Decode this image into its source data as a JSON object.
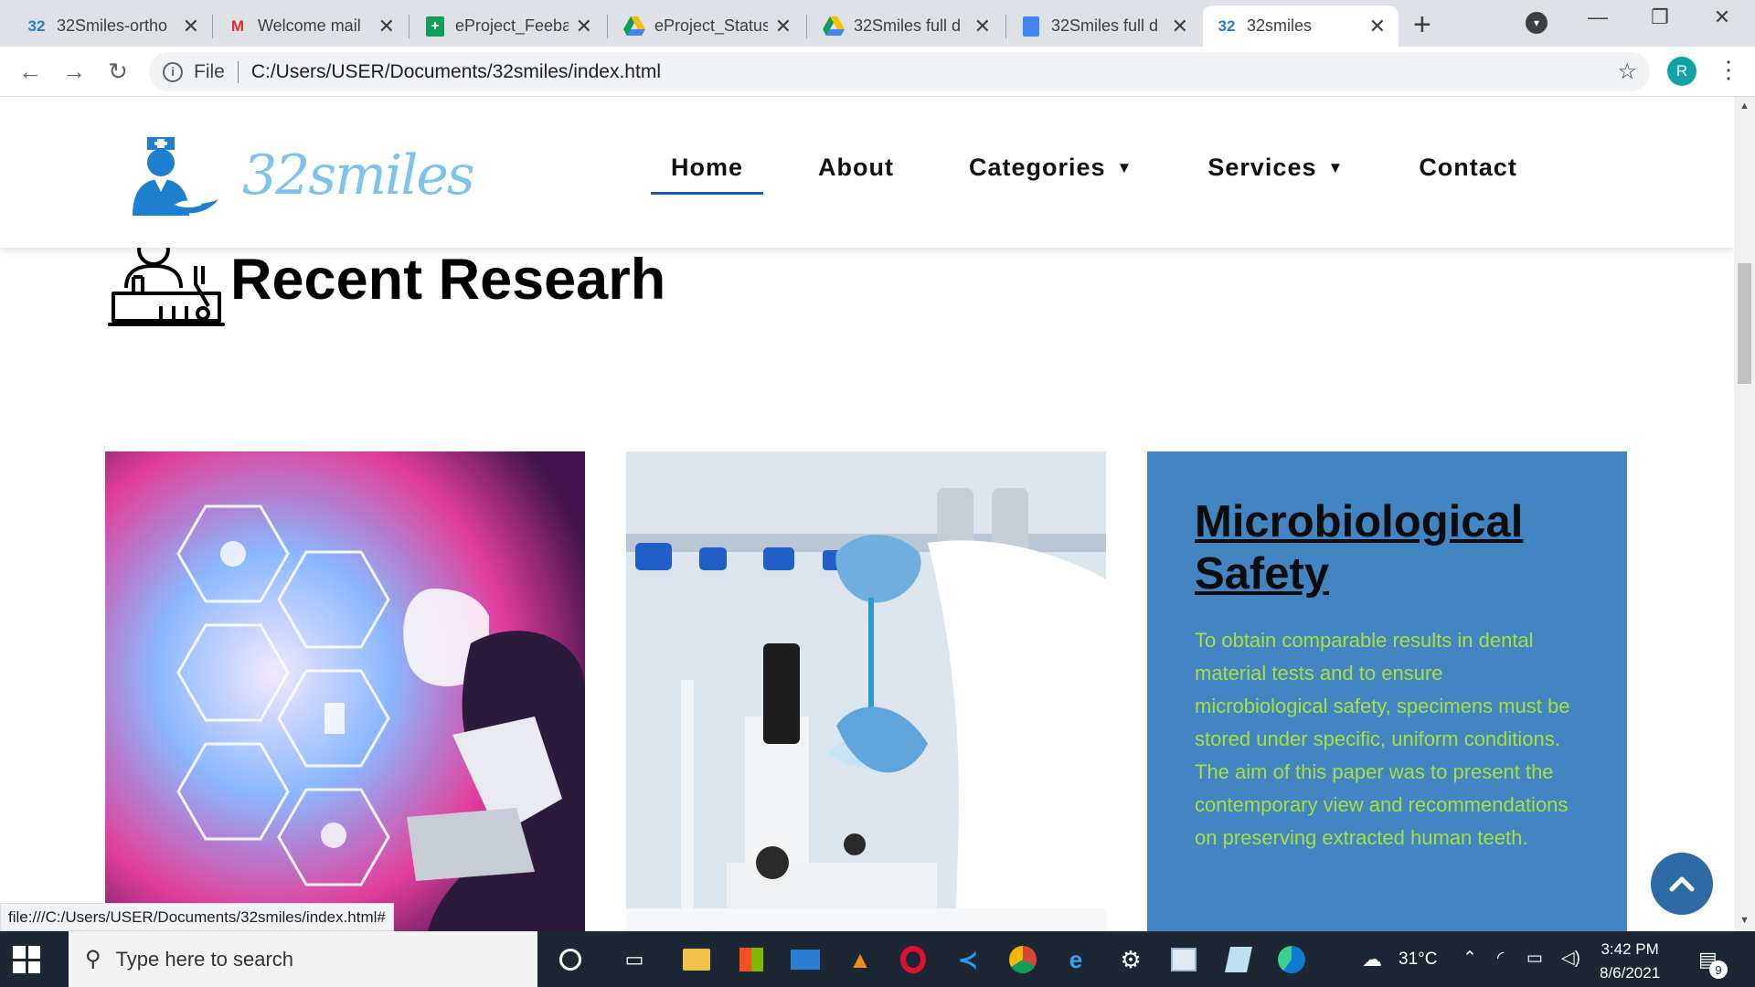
{
  "browser": {
    "tabs": [
      {
        "label": "32Smiles-ortho",
        "icon": "32-logo-icon"
      },
      {
        "label": "Welcome mail",
        "icon": "gmail-icon"
      },
      {
        "label": "eProject_Feeba",
        "icon": "sheets-icon"
      },
      {
        "label": "eProject_Status",
        "icon": "drive-icon"
      },
      {
        "label": "32Smiles full d",
        "icon": "drive-icon"
      },
      {
        "label": "32Smiles full d",
        "icon": "docs-icon"
      },
      {
        "label": "32smiles",
        "icon": "32-logo-icon"
      }
    ],
    "url_scheme": "File",
    "url": "C:/Users/USER/Documents/32smiles/index.html",
    "profile_initial": "R",
    "status_url": "file:///C:/Users/USER/Documents/32smiles/index.html#"
  },
  "site": {
    "logo_text": "32smiles",
    "nav": [
      {
        "label": "Home",
        "active": true,
        "dropdown": false
      },
      {
        "label": "About",
        "active": false,
        "dropdown": false
      },
      {
        "label": "Categories",
        "active": false,
        "dropdown": true
      },
      {
        "label": "Services",
        "active": false,
        "dropdown": true
      },
      {
        "label": "Contact",
        "active": false,
        "dropdown": false
      }
    ],
    "section_title": "Recent Researh",
    "card3": {
      "title": "Microbiological Safety",
      "text": "To obtain comparable results in dental material tests and to ensure microbiological safety, specimens must be stored under specific, uniform conditions. The aim of this paper was to present the contemporary view and recommendations on preserving extracted human teeth."
    }
  },
  "taskbar": {
    "search_placeholder": "Type here to search",
    "weather": "31°C",
    "time": "3:42 PM",
    "date": "8/6/2021",
    "notification_count": "9"
  },
  "colors": {
    "accent_blue": "#1a5ca8",
    "card_blue": "#4384c3",
    "card_text_green": "#a5e043",
    "logo_blue": "#7cc4ec"
  }
}
